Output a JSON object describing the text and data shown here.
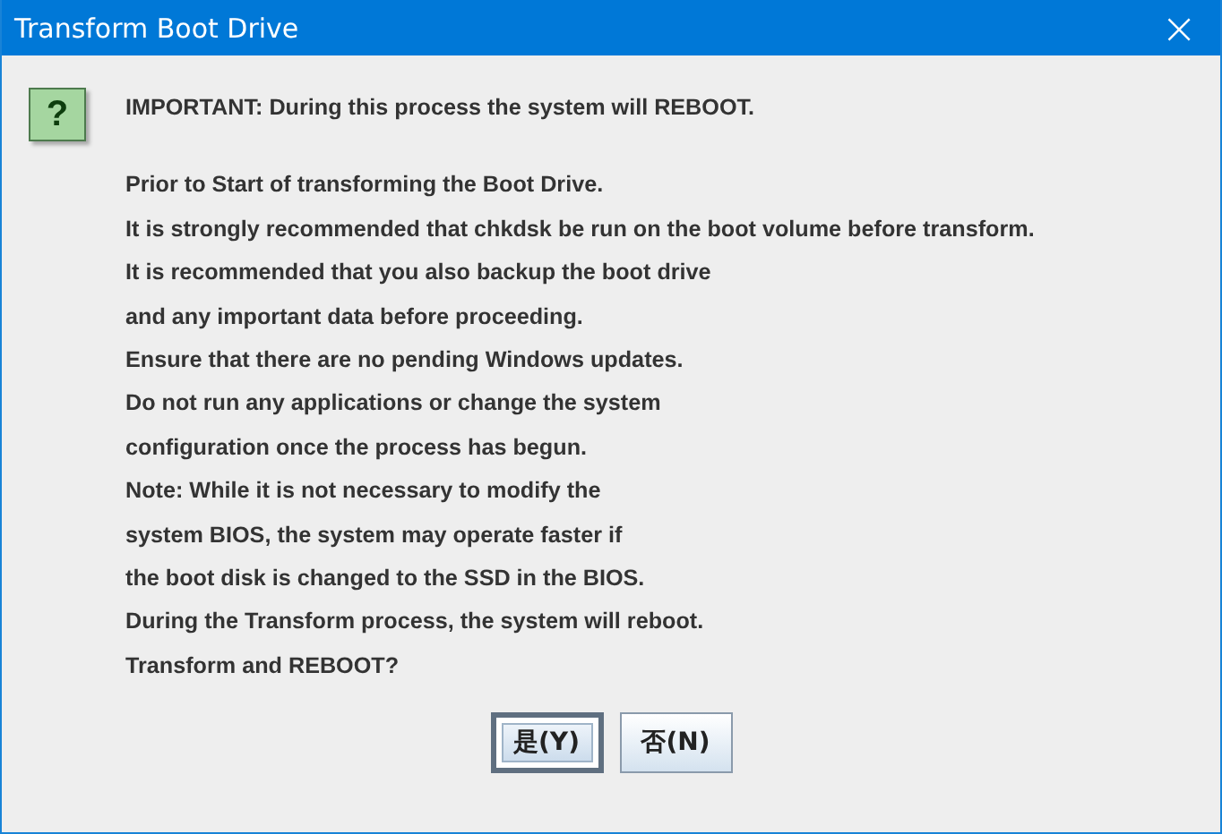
{
  "window": {
    "title": "Transform Boot Drive",
    "close": "×"
  },
  "icon": {
    "glyph": "?"
  },
  "heading": "IMPORTANT: During this process the system will REBOOT.",
  "lines": [
    "Prior to Start of transforming the Boot Drive.",
    "It is strongly recommended that chkdsk be run on the boot volume before transform.",
    "It is recommended that you also backup the boot drive",
    "and any important data before proceeding.",
    "Ensure that there are no pending Windows updates.",
    "Do not run any applications or change the system",
    "configuration once the process has begun.",
    "Note: While it is not necessary to modify the",
    "system BIOS, the system may operate faster if",
    "the boot disk is changed to the SSD in the BIOS.",
    "During the Transform process, the system will reboot.",
    "Transform and REBOOT?"
  ],
  "buttons": [
    {
      "label": "是(Y)",
      "selected": true
    },
    {
      "label": "否(N)",
      "selected": false
    }
  ]
}
